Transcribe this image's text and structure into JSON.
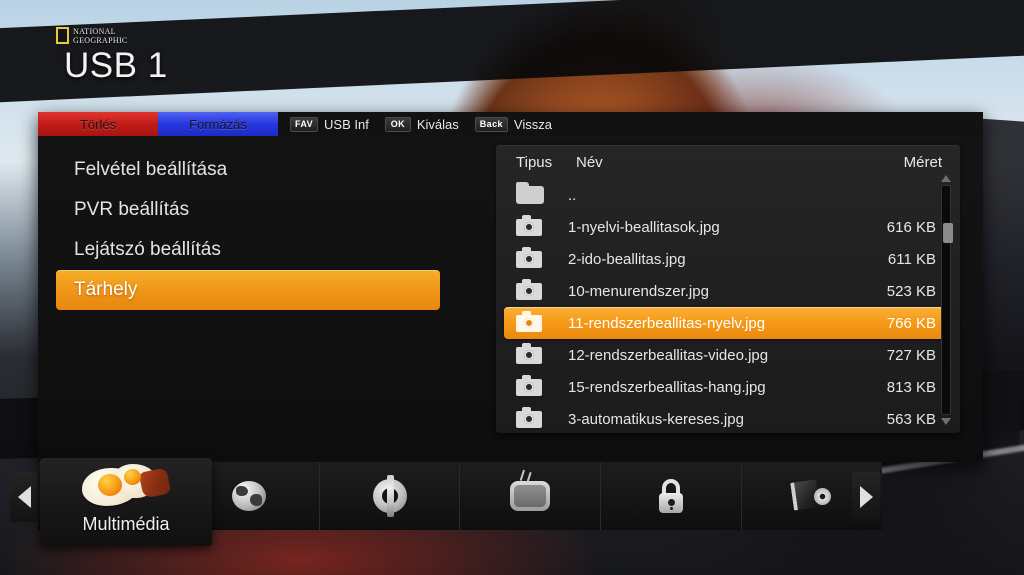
{
  "header": {
    "logo_line1": "NATIONAL",
    "logo_line2": "GEOGRAPHIC",
    "title": "USB 1"
  },
  "actionbar": {
    "buttons": [
      {
        "label": "Törlés",
        "color": "#c01d18"
      },
      {
        "label": "Formázás",
        "color": "#2637dd"
      }
    ],
    "hints": [
      {
        "key": "FAV",
        "label": "USB Inf"
      },
      {
        "key": "OK",
        "label": "Kiválas"
      },
      {
        "key": "Back",
        "label": "Vissza"
      }
    ]
  },
  "menu": {
    "items": [
      {
        "label": "Felvétel beállítása",
        "selected": false
      },
      {
        "label": "PVR beállítás",
        "selected": false
      },
      {
        "label": "Lejátszó beállítás",
        "selected": false
      },
      {
        "label": "Tárhely",
        "selected": true
      }
    ]
  },
  "browser": {
    "columns": {
      "type": "Tipus",
      "name": "Név",
      "size": "Méret"
    },
    "rows": [
      {
        "icon": "folder-icon",
        "name": "..",
        "size": "",
        "selected": false
      },
      {
        "icon": "camera-icon",
        "name": "1-nyelvi-beallitasok.jpg",
        "size": "616 KB",
        "selected": false
      },
      {
        "icon": "camera-icon",
        "name": "2-ido-beallitas.jpg",
        "size": "611 KB",
        "selected": false
      },
      {
        "icon": "camera-icon",
        "name": "10-menurendszer.jpg",
        "size": "523 KB",
        "selected": false
      },
      {
        "icon": "camera-icon",
        "name": "11-rendszerbeallitas-nyelv.jpg",
        "size": "766 KB",
        "selected": true
      },
      {
        "icon": "camera-icon",
        "name": "12-rendszerbeallitas-video.jpg",
        "size": "727 KB",
        "selected": false
      },
      {
        "icon": "camera-icon",
        "name": "15-rendszerbeallitas-hang.jpg",
        "size": "813 KB",
        "selected": false
      },
      {
        "icon": "camera-icon",
        "name": "3-automatikus-kereses.jpg",
        "size": "563 KB",
        "selected": false
      }
    ]
  },
  "toolbar": {
    "active_tile": {
      "label": "Multimédia",
      "icon": "fried-egg-icon"
    },
    "items": [
      {
        "icon": "globe-icon"
      },
      {
        "icon": "gear-icon"
      },
      {
        "icon": "tv-icon"
      },
      {
        "icon": "lock-icon"
      },
      {
        "icon": "book-disc-icon"
      }
    ],
    "prev_arrow": "chevron-left-icon",
    "next_arrow": "chevron-right-icon"
  },
  "colors": {
    "highlight_orange": "#f0981a",
    "delete_red": "#c01d18",
    "format_blue": "#2637dd",
    "panel_bg": "#121212"
  }
}
